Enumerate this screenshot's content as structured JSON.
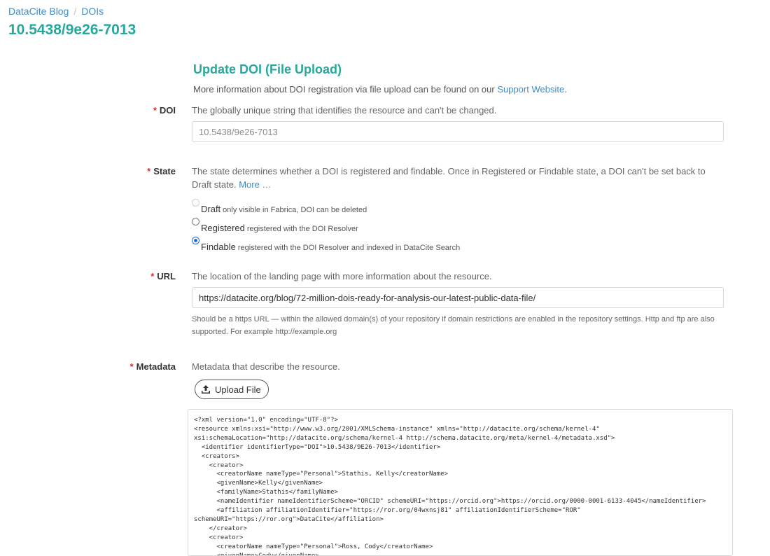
{
  "breadcrumb": {
    "items": [
      "DataCite Blog",
      "DOIs"
    ],
    "separator": "/"
  },
  "page_title": "10.5438/9e26-7013",
  "form": {
    "title": "Update DOI (File Upload)",
    "intro_text": "More information about DOI registration via file upload can be found on our ",
    "intro_link": "Support Website",
    "intro_end": ".",
    "required_marker": "*",
    "doi": {
      "label": "DOI",
      "help": "The globally unique string that identifies the resource and can't be changed.",
      "value": "10.5438/9e26-7013"
    },
    "state": {
      "label": "State",
      "help": "The state determines whether a DOI is registered and findable. Once in Registered or Findable state, a DOI can't be set back to Draft state.",
      "more_link": "More …",
      "options": [
        {
          "name": "Draft",
          "desc": "only visible in Fabrica, DOI can be deleted",
          "checked": false,
          "disabled": true
        },
        {
          "name": "Registered",
          "desc": "registered with the DOI Resolver",
          "checked": false,
          "disabled": false
        },
        {
          "name": "Findable",
          "desc": "registered with the DOI Resolver and indexed in DataCite Search",
          "checked": true,
          "disabled": false
        }
      ]
    },
    "url": {
      "label": "URL",
      "help": "The location of the landing page with more information about the resource.",
      "value": "https://datacite.org/blog/72-million-dois-ready-for-analysis-our-latest-public-data-file/",
      "hint": "Should be a https URL — within the allowed domain(s) of your repository if domain restrictions are enabled in the repository settings. Http and ftp are also supported. For example http://example.org"
    },
    "metadata": {
      "label": "Metadata",
      "help": "Metadata that describe the resource.",
      "upload_label": "Upload File",
      "upload_icon": "upload-icon",
      "xml": "<?xml version=\"1.0\" encoding=\"UTF-8\"?>\n<resource xmlns:xsi=\"http://www.w3.org/2001/XMLSchema-instance\" xmlns=\"http://datacite.org/schema/kernel-4\"\nxsi:schemaLocation=\"http://datacite.org/schema/kernel-4 http://schema.datacite.org/meta/kernel-4/metadata.xsd\">\n  <identifier identifierType=\"DOI\">10.5438/9E26-7013</identifier>\n  <creators>\n    <creator>\n      <creatorName nameType=\"Personal\">Stathis, Kelly</creatorName>\n      <givenName>Kelly</givenName>\n      <familyName>Stathis</familyName>\n      <nameIdentifier nameIdentifierScheme=\"ORCID\" schemeURI=\"https://orcid.org\">https://orcid.org/0000-0001-6133-4045</nameIdentifier>\n      <affiliation affiliationIdentifier=\"https://ror.org/04wxnsj81\" affiliationIdentifierScheme=\"ROR\"\nschemeURI=\"https://ror.org\">DataCite</affiliation>\n    </creator>\n    <creator>\n      <creatorName nameType=\"Personal\">Ross, Cody</creatorName>\n      <givenName>Cody</givenName>"
    }
  },
  "colors": {
    "accent": "#28a89c",
    "link": "#3a8ec9",
    "required": "#d9322b"
  }
}
